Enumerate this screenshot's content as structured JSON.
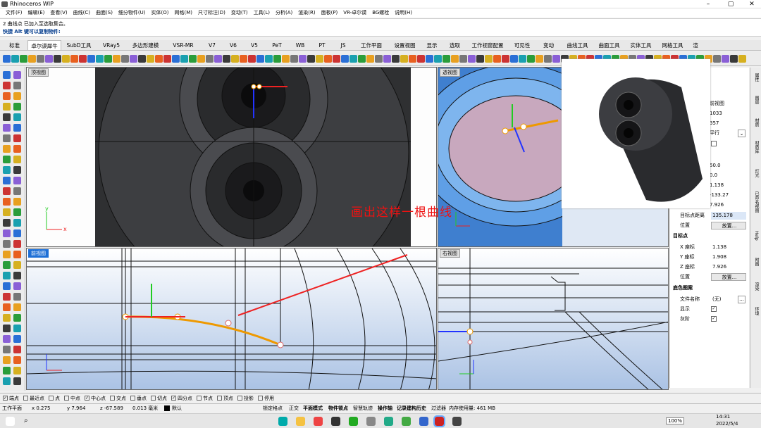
{
  "window": {
    "title": "Rhinoceros WIP"
  },
  "menu": [
    "文件(F)",
    "编辑(E)",
    "查看(V)",
    "曲线(C)",
    "曲面(S)",
    "细分物件(U)",
    "实体(O)",
    "网格(M)",
    "尺寸标注(D)",
    "变动(T)",
    "工具(L)",
    "分析(A)",
    "渲染(R)",
    "面板(P)",
    "VR-卓尔谟",
    "BG螺栓",
    "说明(H)"
  ],
  "command": {
    "history": "2 曲线点 已加入至选取集合。",
    "prompt": "快捷 Alt 键可以复制物件:"
  },
  "tabs": [
    "标准",
    "卓尔谟犀牛",
    "SubD工具",
    "VRay5",
    "多边形建模",
    "VSR-MR",
    "V7",
    "V6",
    "V5",
    "PeT",
    "WB",
    "PT",
    "JS",
    "工作平面",
    "设置视图",
    "显示",
    "选取",
    "工作视窗配置",
    "可见性",
    "变动",
    "曲线工具",
    "曲面工具",
    "实体工具",
    "网格工具",
    "渲"
  ],
  "viewports": {
    "top": "顶视图",
    "perspective": "透视图",
    "front": "前视图",
    "right": "右视图"
  },
  "annotation": "画出这样一根曲线",
  "properties": {
    "view_name": "前视图",
    "v1": "1033",
    "v2": "357",
    "projection": "平行",
    "a": "50.0",
    "b": "0.0",
    "c": "1.138",
    "d": "-133.27",
    "e": "7.926",
    "target_distance_label": "目标点距离",
    "target_distance": "135.178",
    "position_label": "位置",
    "place_btn": "放置...",
    "target_header": "目标点",
    "x_label": "X 座标",
    "x": "1.138",
    "y_label": "Y 座标",
    "y": "1.908",
    "z_label": "Z 座标",
    "z": "7.926",
    "position2_label": "位置",
    "place_btn2": "放置...",
    "bg_header": "底色图案",
    "filename_label": "文件名称",
    "filename": "(无)",
    "show_label": "显示",
    "gray_label": "灰阶",
    "ellipsis": "..."
  },
  "right_tabs": [
    "属性",
    "图层",
    "材质",
    "材质库",
    "灯光",
    "已命名视图",
    "Help",
    "附图",
    "渲染",
    "环境"
  ],
  "osnaps": [
    {
      "label": "端点",
      "on": true
    },
    {
      "label": "最近点",
      "on": false
    },
    {
      "label": "点",
      "on": false
    },
    {
      "label": "中点",
      "on": false
    },
    {
      "label": "中心点",
      "on": true
    },
    {
      "label": "交点",
      "on": false
    },
    {
      "label": "垂点",
      "on": false
    },
    {
      "label": "切点",
      "on": false
    },
    {
      "label": "四分点",
      "on": true
    },
    {
      "label": "节点",
      "on": false
    },
    {
      "label": "顶点",
      "on": false
    },
    {
      "label": "投影",
      "on": false
    },
    {
      "label": "停用",
      "on": false
    }
  ],
  "status": {
    "cplane": "工作平面",
    "x": "x 0.275",
    "y": "y 7.964",
    "z": "z -67.589",
    "unit": "0.013 毫米",
    "layer": "默认",
    "toggles": [
      "锁定格点",
      "正交",
      "平面模式",
      "物件锁点",
      "智慧轨迹",
      "操作轴",
      "记录建构历史",
      "过滤器"
    ],
    "memory": "内存使用量: 461 MB"
  },
  "taskbar": {
    "time": "14:31",
    "date": "2022/5/4",
    "battery": "100%"
  }
}
